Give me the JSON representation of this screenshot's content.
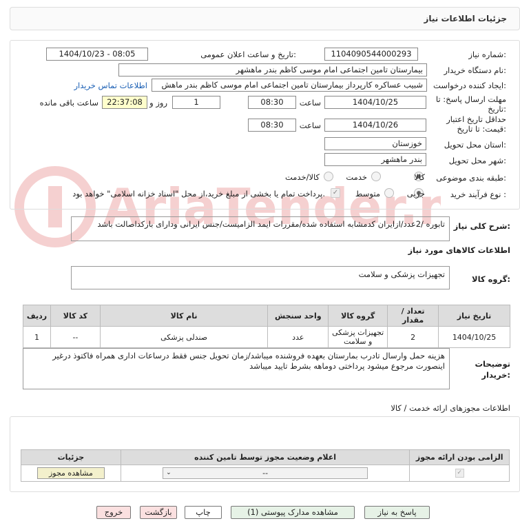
{
  "header": {
    "title": "جزئیات اطلاعات نیاز"
  },
  "fields": {
    "need_number_label": "شماره نیاز:",
    "need_number": "1104090544000293",
    "announce_label": "تاریخ و ساعت اعلان عمومی:",
    "announce_value": "1404/10/23 - 08:05",
    "buyer_label": "نام دستگاه خریدار:",
    "buyer_value": "بیمارستان تامین اجتماعی امام موسی کاظم بندر ماهشهر",
    "requester_label": "ایجاد کننده درخواست:",
    "requester_value": "شبیب عساکره کارپرداز بیمارستان تامین اجتماعی امام موسی کاظم بندر ماهش",
    "contact_link": "اطلاعات تماس خریدار",
    "deadline_label": "مهلت ارسال پاسخ: تا تاریخ:",
    "deadline_date": "1404/10/25",
    "time_label": "ساعت",
    "deadline_time": "08:30",
    "days_value": "1",
    "days_label": "روز و",
    "remaining_time": "22:37:08",
    "remaining_label": "ساعت باقی مانده",
    "validity_label": "حداقل تاریخ اعتبار قیمت: تا تاریخ:",
    "validity_date": "1404/10/26",
    "validity_time": "08:30",
    "province_label": "استان محل تحویل:",
    "province_value": "خوزستان",
    "city_label": "شهر محل تحویل:",
    "city_value": "بندر ماهشهر",
    "category_label": "طبقه بندی موضوعی:",
    "cat_goods": "کالا",
    "cat_service": "خدمت",
    "cat_both": "کالا/خدمت",
    "process_label": "نوع فرآیند خرید :",
    "proc_partial": "جزیی",
    "proc_medium": "متوسط",
    "payment_note": "پرداخت تمام یا بخشی از مبلغ خرید،از محل \"اسناد خزانه اسلامی\" خواهد بود."
  },
  "description": {
    "label": "شرح کلی نیاز:",
    "text": "تابوره /2عدد/ازایران کدمشابه استفاده شده/مقررات ایمد الزامیست/جنس ایرانی ودارای بارکداصالت باشد"
  },
  "goods_info_title": "اطلاعات کالاهای مورد نیاز",
  "goods_group": {
    "label": "گروه کالا:",
    "value": "تجهیزات پزشکی و سلامت"
  },
  "items_table": {
    "headers": [
      "ردیف",
      "کد کالا",
      "نام کالا",
      "واحد سنجش",
      "گروه کالا",
      "تعداد / مقدار",
      "تاریخ نیاز"
    ],
    "rows": [
      [
        "1",
        "--",
        "صندلی پزشکی",
        "عدد",
        "تجهیزات پزشکی و سلامت",
        "2",
        "1404/10/25"
      ]
    ]
  },
  "buyer_notes": {
    "label": "توضیحات خریدار:",
    "text": "هزینه حمل وارسال تادرب بمارستان بعهده فروشنده میباشد/زمان تحویل جنس فقط درساعات اداری همراه فاکتوذ درغیر اینصورت مرجوع میشود پرداختی دوماهه بشرط تایید میباشد"
  },
  "permits": {
    "title": "اطلاعات مجوزهای ارائه خدمت / کالا",
    "headers": [
      "الزامی بودن ارائه مجوز",
      "اعلام وضعیت مجوز توسط تامین کننده",
      "جزئیات"
    ],
    "select_value": "--",
    "view_button": "مشاهده مجوز"
  },
  "buttons": {
    "reply": "پاسخ به نیاز",
    "attachments": "مشاهده مدارک پیوستی (1)",
    "print": "چاپ",
    "back": "بازگشت",
    "exit": "خروج"
  },
  "watermark": "AriaTender.neT"
}
